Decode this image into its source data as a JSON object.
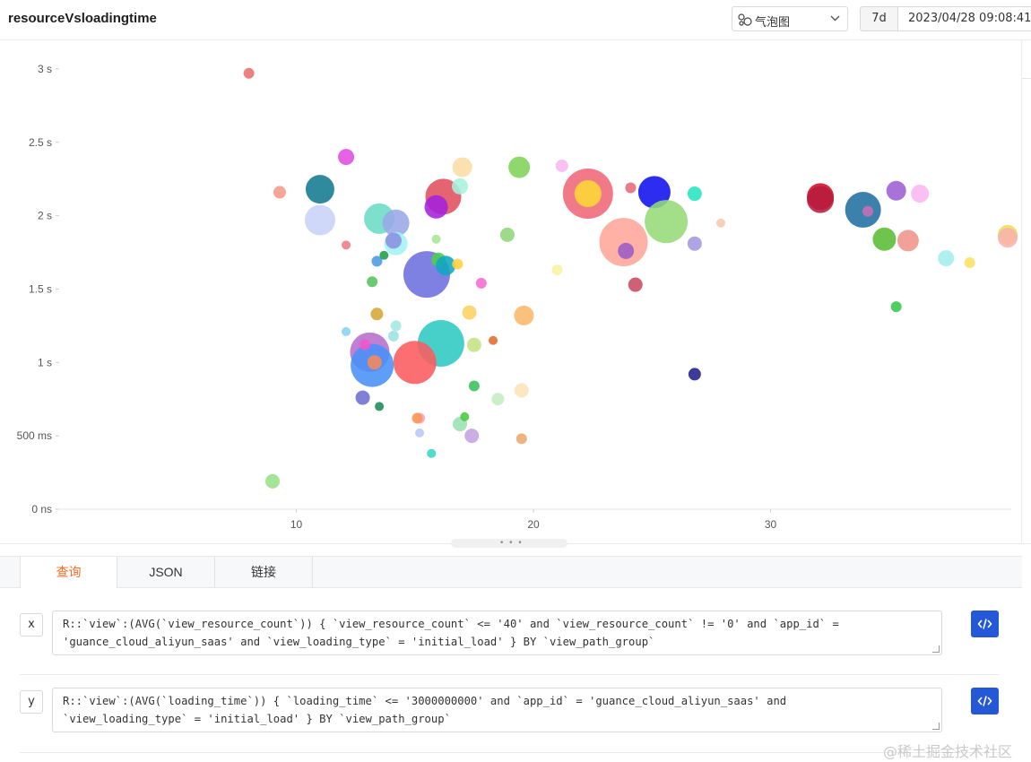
{
  "header": {
    "title": "resourceVsloadingtime",
    "chart_type_label": "气泡图",
    "chart_type_icon": "bubble-chart-icon",
    "time_range_label": "7d",
    "time_value": "2023/04/28 09:08:41"
  },
  "chart_data": {
    "type": "scatter",
    "subtype": "bubble",
    "x_ticks": [
      "10",
      "20",
      "30"
    ],
    "y_ticks": [
      "0 ns",
      "500 ms",
      "1 s",
      "1.5 s",
      "2 s",
      "2.5 s",
      "3 s"
    ],
    "xlim": [
      0,
      40
    ],
    "ylim": [
      0,
      3
    ],
    "x_unit": "view_resource_count",
    "y_unit": "seconds",
    "grid": false,
    "legend": "none",
    "points": [
      {
        "x": 8,
        "y": 2.97,
        "r": 6,
        "color": "#e8706e"
      },
      {
        "x": 9.3,
        "y": 2.16,
        "r": 7,
        "color": "#f59a88"
      },
      {
        "x": 12.1,
        "y": 2.4,
        "r": 9,
        "color": "#e34ce0"
      },
      {
        "x": 11,
        "y": 2.18,
        "r": 16,
        "color": "#137a91"
      },
      {
        "x": 11,
        "y": 1.97,
        "r": 17,
        "color": "#c8d3f7"
      },
      {
        "x": 12.1,
        "y": 1.8,
        "r": 5,
        "color": "#f07a86"
      },
      {
        "x": 13.5,
        "y": 1.98,
        "r": 17,
        "color": "#6bdcc5"
      },
      {
        "x": 14.2,
        "y": 1.95,
        "r": 15,
        "color": "#9aa8e8"
      },
      {
        "x": 14.2,
        "y": 1.81,
        "r": 13,
        "color": "#a2f2f2"
      },
      {
        "x": 14.1,
        "y": 1.83,
        "r": 9,
        "color": "#8a8fe0"
      },
      {
        "x": 13.4,
        "y": 1.69,
        "r": 6,
        "color": "#4a98e0"
      },
      {
        "x": 13.7,
        "y": 1.73,
        "r": 5,
        "color": "#199e4a"
      },
      {
        "x": 13.2,
        "y": 1.55,
        "r": 6,
        "color": "#52c45d"
      },
      {
        "x": 15.5,
        "y": 1.6,
        "r": 26,
        "color": "#6c6fde"
      },
      {
        "x": 16.2,
        "y": 2.13,
        "r": 20,
        "color": "#e0505d"
      },
      {
        "x": 15.9,
        "y": 2.06,
        "r": 13,
        "color": "#a421dd"
      },
      {
        "x": 17,
        "y": 2.33,
        "r": 11,
        "color": "#fadca5"
      },
      {
        "x": 16.9,
        "y": 2.2,
        "r": 9,
        "color": "#a5f2dd"
      },
      {
        "x": 15.9,
        "y": 1.84,
        "r": 5,
        "color": "#a5e694"
      },
      {
        "x": 16,
        "y": 1.7,
        "r": 8,
        "color": "#4dcf4b"
      },
      {
        "x": 16.3,
        "y": 1.66,
        "r": 11,
        "color": "#0fa7bf"
      },
      {
        "x": 16.8,
        "y": 1.67,
        "r": 6,
        "color": "#ffd23b"
      },
      {
        "x": 17.8,
        "y": 1.54,
        "r": 6,
        "color": "#f56bd2"
      },
      {
        "x": 19.4,
        "y": 2.33,
        "r": 12,
        "color": "#7fd458"
      },
      {
        "x": 18.9,
        "y": 1.87,
        "r": 8,
        "color": "#8fd67a"
      },
      {
        "x": 21.2,
        "y": 2.34,
        "r": 7,
        "color": "#f7b8f0"
      },
      {
        "x": 22.3,
        "y": 2.15,
        "r": 28,
        "color": "#f06677"
      },
      {
        "x": 22.3,
        "y": 2.15,
        "r": 15,
        "color": "#fdd835"
      },
      {
        "x": 24.1,
        "y": 2.19,
        "r": 6,
        "color": "#e56a77"
      },
      {
        "x": 25.1,
        "y": 2.16,
        "r": 18,
        "color": "#1010f0"
      },
      {
        "x": 26.8,
        "y": 2.15,
        "r": 8,
        "color": "#25e5c2"
      },
      {
        "x": 23.8,
        "y": 1.82,
        "r": 27,
        "color": "#ffa699"
      },
      {
        "x": 23.9,
        "y": 1.76,
        "r": 9,
        "color": "#9a5bc7"
      },
      {
        "x": 25.6,
        "y": 1.96,
        "r": 24,
        "color": "#96d977"
      },
      {
        "x": 26.8,
        "y": 1.81,
        "r": 8,
        "color": "#a599e0"
      },
      {
        "x": 27.9,
        "y": 1.95,
        "r": 5,
        "color": "#fbc7b0"
      },
      {
        "x": 24.3,
        "y": 1.53,
        "r": 8,
        "color": "#c94b62"
      },
      {
        "x": 21,
        "y": 1.63,
        "r": 6,
        "color": "#fbf2a0"
      },
      {
        "x": 19.6,
        "y": 1.32,
        "r": 11,
        "color": "#fbb86a"
      },
      {
        "x": 17.3,
        "y": 1.34,
        "r": 8,
        "color": "#fcd162"
      },
      {
        "x": 18.3,
        "y": 1.15,
        "r": 5,
        "color": "#e06b2c"
      },
      {
        "x": 17.5,
        "y": 1.12,
        "r": 8,
        "color": "#c3e381"
      },
      {
        "x": 16.1,
        "y": 1.13,
        "r": 26,
        "color": "#2ec9c2"
      },
      {
        "x": 15,
        "y": 1.0,
        "r": 24,
        "color": "#fb5b5e"
      },
      {
        "x": 13.1,
        "y": 1.07,
        "r": 22,
        "color": "#b66ecd"
      },
      {
        "x": 13.2,
        "y": 0.98,
        "r": 24,
        "color": "#4891f8"
      },
      {
        "x": 12.9,
        "y": 1.12,
        "r": 6,
        "color": "#f554c9"
      },
      {
        "x": 13.3,
        "y": 1.0,
        "r": 8,
        "color": "#f58a5c"
      },
      {
        "x": 12.1,
        "y": 1.21,
        "r": 5,
        "color": "#86d2f2"
      },
      {
        "x": 14.2,
        "y": 1.25,
        "r": 6,
        "color": "#a4e8e1"
      },
      {
        "x": 14.1,
        "y": 1.18,
        "r": 6,
        "color": "#9ae3e3"
      },
      {
        "x": 13.4,
        "y": 1.33,
        "r": 7,
        "color": "#d6a536"
      },
      {
        "x": 12.8,
        "y": 0.76,
        "r": 8,
        "color": "#6d6fd1"
      },
      {
        "x": 13.5,
        "y": 0.7,
        "r": 5,
        "color": "#1a8a58"
      },
      {
        "x": 15.2,
        "y": 0.62,
        "r": 6,
        "color": "#f9a0c3"
      },
      {
        "x": 15.1,
        "y": 0.62,
        "r": 6,
        "color": "#f59a55"
      },
      {
        "x": 15.2,
        "y": 0.52,
        "r": 5,
        "color": "#b8c8f5"
      },
      {
        "x": 15.7,
        "y": 0.38,
        "r": 5,
        "color": "#3ad6c4"
      },
      {
        "x": 16.9,
        "y": 0.58,
        "r": 8,
        "color": "#9ae0b0"
      },
      {
        "x": 17.1,
        "y": 0.63,
        "r": 5,
        "color": "#47c93f"
      },
      {
        "x": 17.4,
        "y": 0.5,
        "r": 8,
        "color": "#c4a3e0"
      },
      {
        "x": 17.5,
        "y": 0.84,
        "r": 6,
        "color": "#3ac05a"
      },
      {
        "x": 18.5,
        "y": 0.75,
        "r": 7,
        "color": "#c4edc0"
      },
      {
        "x": 19.5,
        "y": 0.81,
        "r": 8,
        "color": "#fbe4b9"
      },
      {
        "x": 19.5,
        "y": 0.48,
        "r": 6,
        "color": "#ecaa6d"
      },
      {
        "x": 26.8,
        "y": 0.92,
        "r": 7,
        "color": "#23208a"
      },
      {
        "x": 9,
        "y": 0.19,
        "r": 8,
        "color": "#98e088"
      },
      {
        "x": 32.1,
        "y": 2.13,
        "r": 15,
        "color": "#d10a2a"
      },
      {
        "x": 32.1,
        "y": 2.11,
        "r": 15,
        "color": "#b71c3c"
      },
      {
        "x": 33.9,
        "y": 2.04,
        "r": 20,
        "color": "#216fa1"
      },
      {
        "x": 34.1,
        "y": 2.03,
        "r": 6,
        "color": "#c96fb4"
      },
      {
        "x": 35.3,
        "y": 2.17,
        "r": 11,
        "color": "#9d5fd4"
      },
      {
        "x": 36.3,
        "y": 2.15,
        "r": 10,
        "color": "#f9b7ef"
      },
      {
        "x": 34.8,
        "y": 1.84,
        "r": 13,
        "color": "#5abc34"
      },
      {
        "x": 35.8,
        "y": 1.83,
        "r": 12,
        "color": "#f0948a"
      },
      {
        "x": 37.4,
        "y": 1.71,
        "r": 9,
        "color": "#a3eeea"
      },
      {
        "x": 38.4,
        "y": 1.68,
        "r": 6,
        "color": "#fbe060"
      },
      {
        "x": 35.3,
        "y": 1.38,
        "r": 6,
        "color": "#37c84a"
      },
      {
        "x": 40.0,
        "y": 1.87,
        "r": 11,
        "color": "#e8e05a"
      },
      {
        "x": 40.0,
        "y": 1.85,
        "r": 11,
        "color": "#fbb2ad"
      }
    ]
  },
  "tabs": [
    {
      "label": "查询",
      "active": true
    },
    {
      "label": "JSON",
      "active": false
    },
    {
      "label": "链接",
      "active": false
    }
  ],
  "queries": [
    {
      "axis": "x",
      "text": "R::`view`:(AVG(`view_resource_count`)) { `view_resource_count` <= '40' and `view_resource_count` != '0' and `app_id` =\n'guance_cloud_aliyun_saas' and `view_loading_type` = 'initial_load' } BY `view_path_group`",
      "button_icon": "code-icon"
    },
    {
      "axis": "y",
      "text": "R::`view`:(AVG(`loading_time`)) { `loading_time` <= '3000000000' and `app_id` = 'guance_cloud_aliyun_saas' and\n`view_loading_type` = 'initial_load' } BY `view_path_group`",
      "button_icon": "code-icon"
    }
  ],
  "watermark": "@稀土掘金技术社区"
}
